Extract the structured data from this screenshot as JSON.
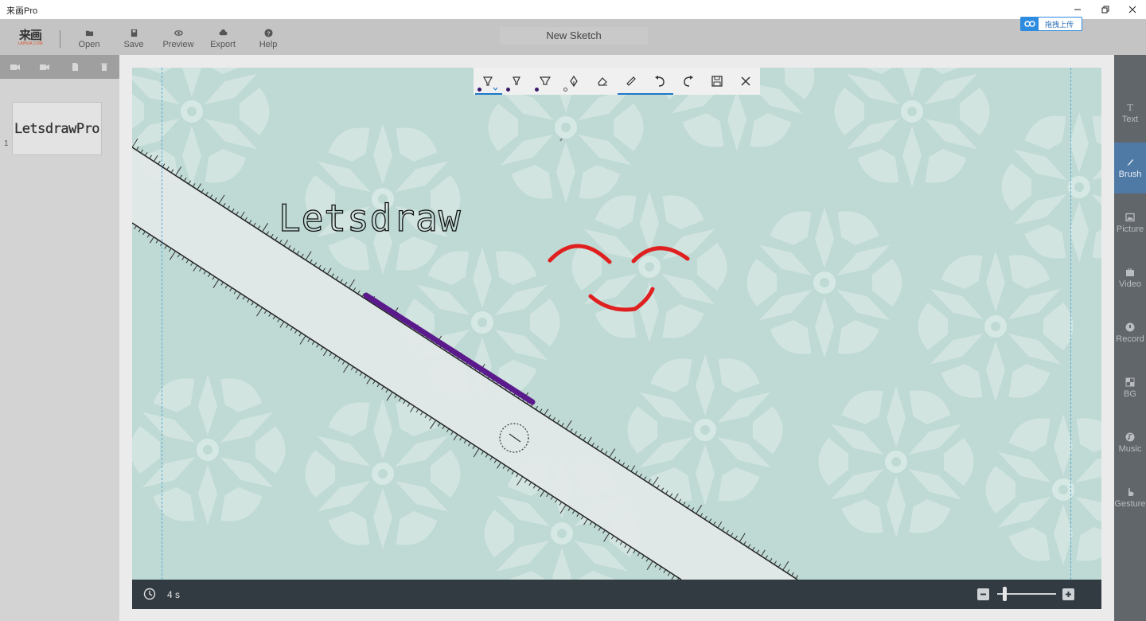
{
  "window": {
    "title": "来画Pro"
  },
  "upload_badge": {
    "label": "拖拽上传"
  },
  "logo": {
    "main": "来画",
    "sub": "LAIHUA.COM"
  },
  "toolbar": {
    "open_label": "Open",
    "save_label": "Save",
    "preview_label": "Preview",
    "export_label": "Export",
    "help_label": "Help",
    "sketch_title": "New Sketch"
  },
  "slides": [
    {
      "number": "1",
      "thumb_text": "LetsdrawPro"
    }
  ],
  "canvas": {
    "text": "Letsdraw"
  },
  "draw_toolbar": {
    "pen_colors": [
      "#3b1a6b",
      "#3b1a6b",
      "#3b1a6b",
      "#555555"
    ]
  },
  "timeline": {
    "time_label": "4 s",
    "zoom_level": 0.1
  },
  "right_panel": {
    "items": [
      {
        "label": "Text",
        "icon": "text-icon"
      },
      {
        "label": "Brush",
        "icon": "brush-icon"
      },
      {
        "label": "Picture",
        "icon": "picture-icon"
      },
      {
        "label": "Video",
        "icon": "video-icon"
      },
      {
        "label": "Record",
        "icon": "record-icon"
      },
      {
        "label": "BG",
        "icon": "bg-icon"
      },
      {
        "label": "Music",
        "icon": "music-icon"
      },
      {
        "label": "Gesture",
        "icon": "gesture-icon"
      }
    ],
    "active": "Brush"
  },
  "colors": {
    "stroke_purple": "#5b1a8c",
    "stroke_red": "#e01f1f",
    "accent_blue": "#1e78c8",
    "canvas_bg": "#bfd9d4"
  }
}
